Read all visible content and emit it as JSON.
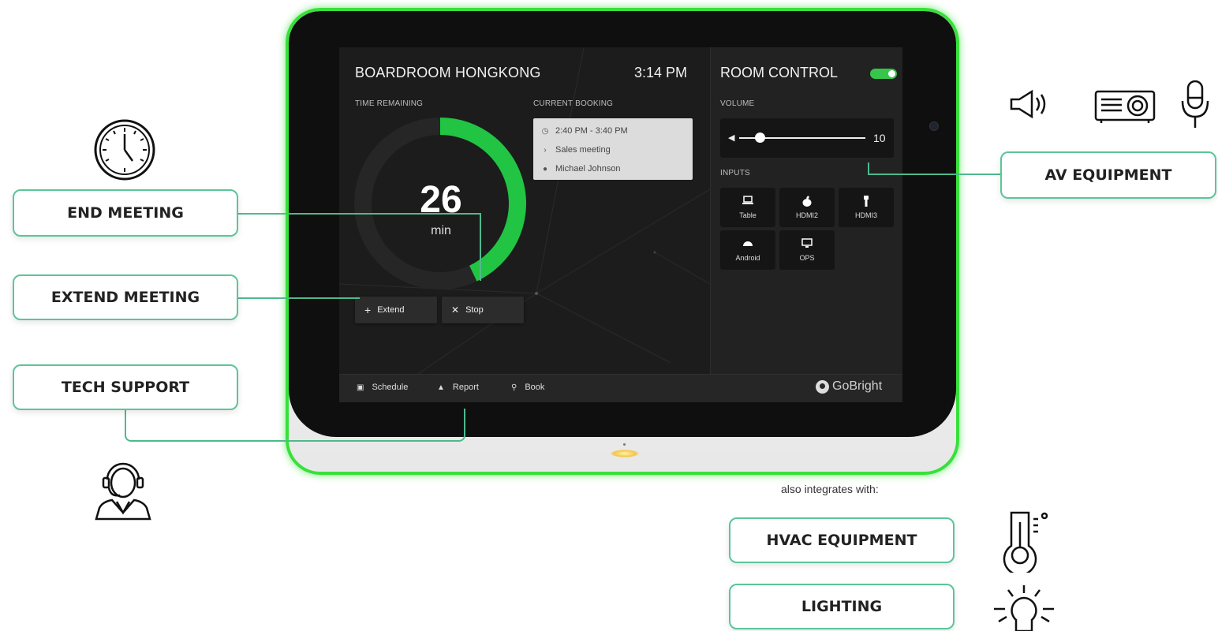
{
  "room": {
    "name": "BOARDROOM HONGKONG",
    "time": "3:14 PM",
    "time_remaining_label": "TIME REMAINING",
    "minutes": "26",
    "minutes_unit": "min",
    "remaining_fraction": 0.43
  },
  "booking": {
    "label": "CURRENT BOOKING",
    "time_range": "2:40 PM - 3:40 PM",
    "subject": "Sales meeting",
    "organizer": "Michael Johnson"
  },
  "actions": {
    "extend": "Extend",
    "stop": "Stop"
  },
  "room_control": {
    "title": "ROOM CONTROL",
    "enabled": true,
    "volume_label": "VOLUME",
    "volume_value": "10",
    "volume_level": 0.1,
    "inputs_label": "INPUTS",
    "inputs": [
      {
        "label": "Table",
        "icon": "laptop-icon"
      },
      {
        "label": "HDMI2",
        "icon": "apple-icon"
      },
      {
        "label": "HDMI3",
        "icon": "usb-icon"
      },
      {
        "label": "Android",
        "icon": "android-icon"
      },
      {
        "label": "OPS",
        "icon": "monitor-icon"
      }
    ]
  },
  "bottom_bar": {
    "schedule": "Schedule",
    "report": "Report",
    "book": "Book",
    "brand": "GoBright"
  },
  "callouts": {
    "end_meeting": "END MEETING",
    "extend_meeting": "EXTEND MEETING",
    "tech_support": "TECH SUPPORT",
    "av_equipment": "AV EQUIPMENT",
    "hvac_equipment": "HVAC EQUIPMENT",
    "lighting": "LIGHTING",
    "integrates_text": "also integrates with:"
  },
  "colors": {
    "accent_green": "#22c443",
    "tablet_glow": "#38e03a",
    "callout_border": "#5cc59a"
  }
}
